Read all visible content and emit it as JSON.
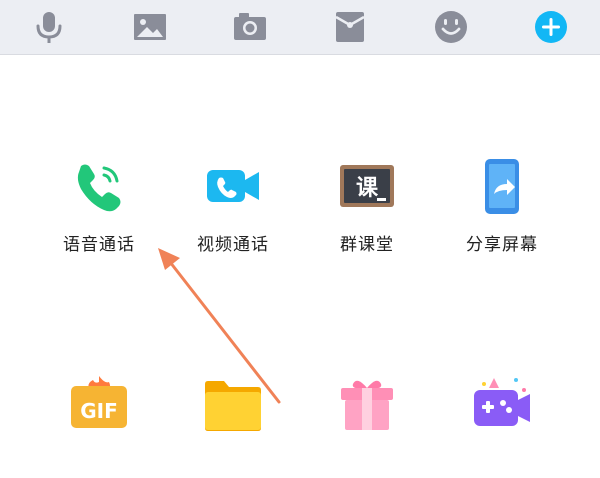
{
  "toolbar": {
    "icons": [
      "microphone-icon",
      "image-icon",
      "camera-icon",
      "red-envelope-icon",
      "emoji-icon",
      "plus-icon"
    ]
  },
  "apps": {
    "row1": [
      {
        "label": "语音通话",
        "icon": "phone-icon"
      },
      {
        "label": "视频通话",
        "icon": "video-call-icon"
      },
      {
        "label": "群课堂",
        "icon": "classroom-board-icon",
        "badge": "课"
      },
      {
        "label": "分享屏幕",
        "icon": "share-screen-icon"
      }
    ],
    "row2": [
      {
        "label": "",
        "icon": "gif-icon",
        "badge": "GIF"
      },
      {
        "label": "",
        "icon": "folder-icon"
      },
      {
        "label": "",
        "icon": "gift-icon"
      },
      {
        "label": "",
        "icon": "game-icon"
      }
    ]
  },
  "colors": {
    "toolbar_bg": "#eceef3",
    "toolbar_icon": "#8a8d99",
    "accent_blue": "#12b7f5",
    "phone_green": "#22c77a",
    "arrow": "#f08257"
  }
}
